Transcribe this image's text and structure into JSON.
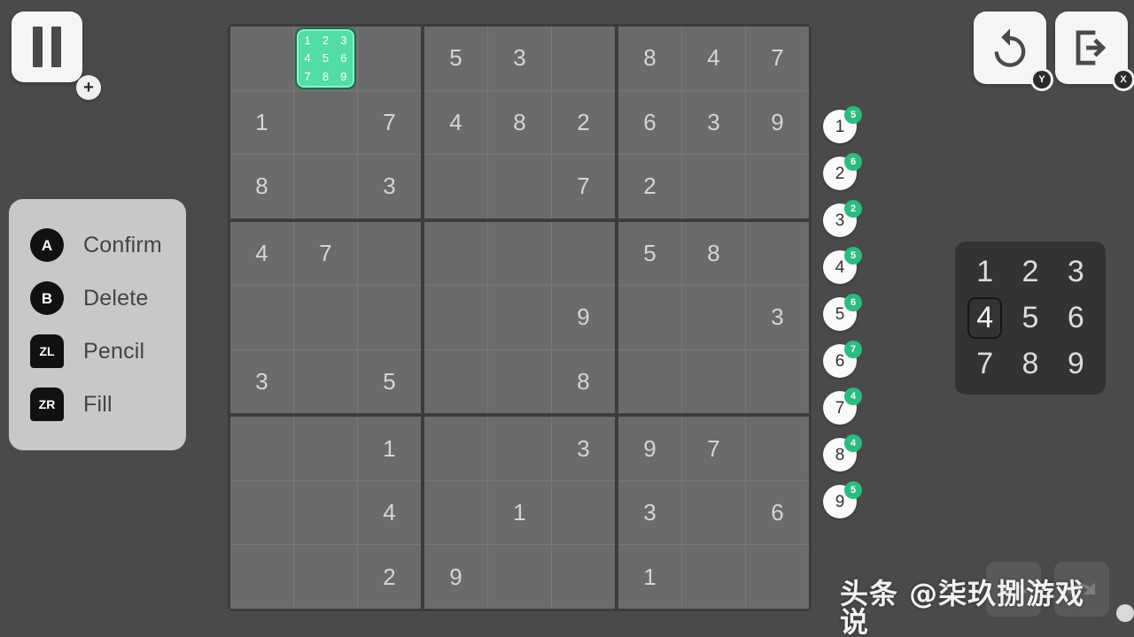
{
  "colors": {
    "background": "#4a4a4a",
    "cell": "#6b6b6b",
    "board_border": "#3c3c3c",
    "accent_green": "#52dda4",
    "badge_green": "#2bbd7e",
    "panel_light": "#c8c8c8",
    "numpad": "#333333"
  },
  "pause": {
    "icon": "pause-icon",
    "hint": "+"
  },
  "top_right": {
    "restart": {
      "icon": "restart-icon",
      "hint": "Y"
    },
    "exit": {
      "icon": "exit-icon",
      "hint": "X"
    }
  },
  "control_hints": [
    {
      "glyph": "A",
      "shape": "round",
      "label": "Confirm"
    },
    {
      "glyph": "B",
      "shape": "round",
      "label": "Delete"
    },
    {
      "glyph": "ZL",
      "shape": "shoulder",
      "label": "Pencil"
    },
    {
      "glyph": "ZR",
      "shape": "shoulder",
      "label": "Fill"
    }
  ],
  "board": {
    "selected_cell": {
      "row": 0,
      "col": 1
    },
    "selected_pencil_notes": [
      "1",
      "2",
      "3",
      "4",
      "5",
      "6",
      "7",
      "8",
      "9"
    ],
    "grid": [
      [
        "",
        "",
        "",
        "5",
        "3",
        "",
        "8",
        "4",
        "7"
      ],
      [
        "1",
        "",
        "7",
        "4",
        "8",
        "2",
        "6",
        "3",
        "9"
      ],
      [
        "8",
        "",
        "3",
        "",
        "",
        "7",
        "2",
        "",
        ""
      ],
      [
        "4",
        "7",
        "",
        "",
        "",
        "",
        "5",
        "8",
        ""
      ],
      [
        "",
        "",
        "",
        "",
        "",
        "9",
        "",
        "",
        "3"
      ],
      [
        "3",
        "",
        "5",
        "",
        "",
        "8",
        "",
        "",
        ""
      ],
      [
        "",
        "",
        "1",
        "",
        "",
        "3",
        "9",
        "7",
        ""
      ],
      [
        "",
        "",
        "4",
        "",
        "1",
        "",
        "3",
        "",
        "6"
      ],
      [
        "",
        "",
        "2",
        "9",
        "",
        "",
        "1",
        "",
        ""
      ]
    ]
  },
  "number_counters": [
    {
      "number": "1",
      "remaining": "5"
    },
    {
      "number": "2",
      "remaining": "6"
    },
    {
      "number": "3",
      "remaining": "2"
    },
    {
      "number": "4",
      "remaining": "5"
    },
    {
      "number": "5",
      "remaining": "6"
    },
    {
      "number": "6",
      "remaining": "7"
    },
    {
      "number": "7",
      "remaining": "4"
    },
    {
      "number": "8",
      "remaining": "4"
    },
    {
      "number": "9",
      "remaining": "5"
    }
  ],
  "number_pad": {
    "keys": [
      "1",
      "2",
      "3",
      "4",
      "5",
      "6",
      "7",
      "8",
      "9"
    ],
    "selected": "4"
  },
  "history": {
    "undo": {
      "icon": "undo-arrow-icon",
      "enabled": false
    },
    "redo": {
      "icon": "redo-arrow-icon",
      "enabled": false
    }
  },
  "watermark": {
    "text": "头条 @柒玖捌游戏说"
  }
}
